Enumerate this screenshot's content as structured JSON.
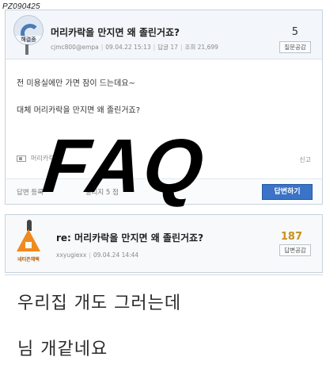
{
  "stamp": "PZ090425",
  "question": {
    "avatar_label": "해결중",
    "title": "머리카락을 만지면 왜 졸린거죠?",
    "author": "cjmc800@empa",
    "date": "09.04.22 15:13",
    "answers": "답글 17",
    "views": "조회 21,699",
    "vote_count": "5",
    "vote_button": "질문공감",
    "body_lines": [
      "전 미용실에만 가면 잠이 드는데요~",
      "대체 머리카락을 만지면 왜 졸린거죠?"
    ],
    "tag_text": "머리카락",
    "report": "신고",
    "footer_notice": "답변 등록",
    "footer_notice_tail": "일리지 5                    점",
    "answer_button": "답변하기"
  },
  "answer": {
    "badge": "네티즌채택",
    "title": "re: 머리카락을 만지면 왜 졸린거죠?",
    "author": "xxyugiexx",
    "date": "09.04.24 14:44",
    "vote_count": "187",
    "vote_button": "답변공감",
    "body_lines": [
      "우리집 개도 그러는데",
      "님 개같네요"
    ]
  },
  "overlay": "FAQ"
}
